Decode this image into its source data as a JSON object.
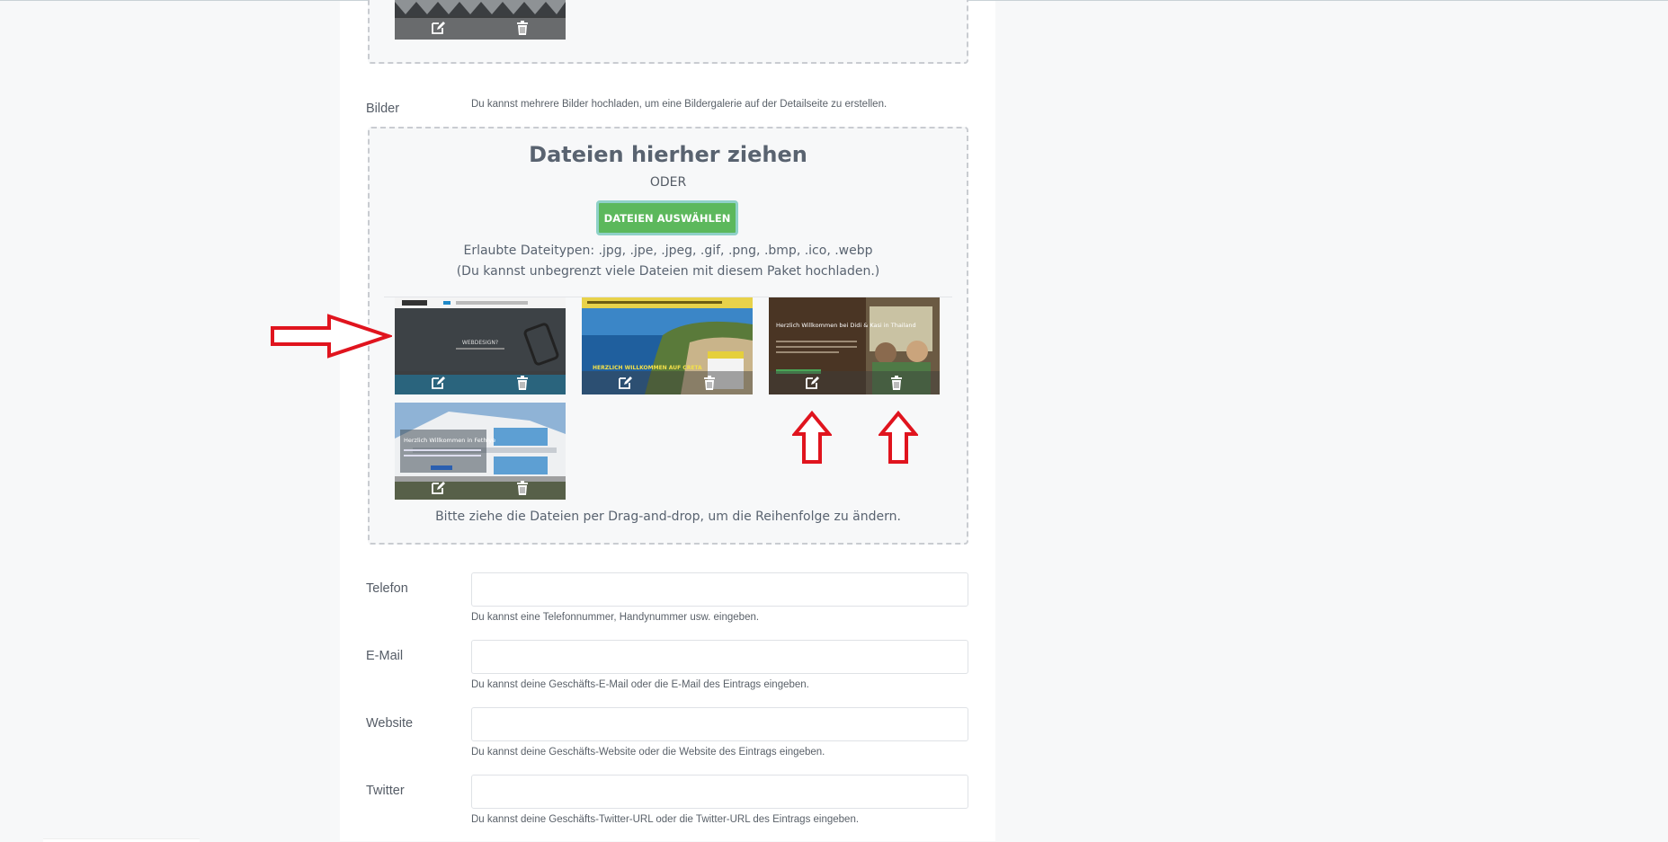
{
  "bilder": {
    "label": "Bilder",
    "hint": "Du kannst mehrere Bilder hochladen, um eine Bildergalerie auf der Detailseite zu erstellen.",
    "drop_title": "Dateien hierher ziehen",
    "or_text": "ODER",
    "select_button": "DATEIEN AUSWÄHLEN",
    "allowed_types": "Erlaubte Dateitypen: .jpg, .jpe, .jpeg, .gif, .png, .bmp, .ico, .webp",
    "limit_note": "(Du kannst unbegrenzt viele Dateien mit diesem Paket hochladen.)",
    "reorder_note": "Bitte ziehe die Dateien per Drag-and-drop, um die Reihenfolge zu ändern.",
    "thumbnails": [
      {
        "title": "WEBDESIGN?"
      },
      {
        "title": "HERZLICH WILLKOMMEN AUF CRETA"
      },
      {
        "title": "Herzlich Willkommen bei Didi & Kasi in Thailand"
      },
      {
        "title": "Herzlich Willkommen in Fethiye"
      }
    ]
  },
  "fields": {
    "telefon": {
      "label": "Telefon",
      "hint": "Du kannst eine Telefonnummer, Handynummer usw. eingeben.",
      "value": ""
    },
    "email": {
      "label": "E-Mail",
      "hint": "Du kannst deine Geschäfts-E-Mail oder die E-Mail des Eintrags eingeben.",
      "value": ""
    },
    "website": {
      "label": "Website",
      "hint": "Du kannst deine Geschäfts-Website oder die Website des Eintrags eingeben.",
      "value": ""
    },
    "twitter": {
      "label": "Twitter",
      "hint": "Du kannst deine Geschäfts-Twitter-URL oder die Twitter-URL des Eintrags eingeben.",
      "value": ""
    }
  },
  "colors": {
    "button": "#5cb85c",
    "annotation_arrow": "#e0141e"
  },
  "icons": {
    "edit": "edit-icon",
    "delete": "trash-icon"
  }
}
